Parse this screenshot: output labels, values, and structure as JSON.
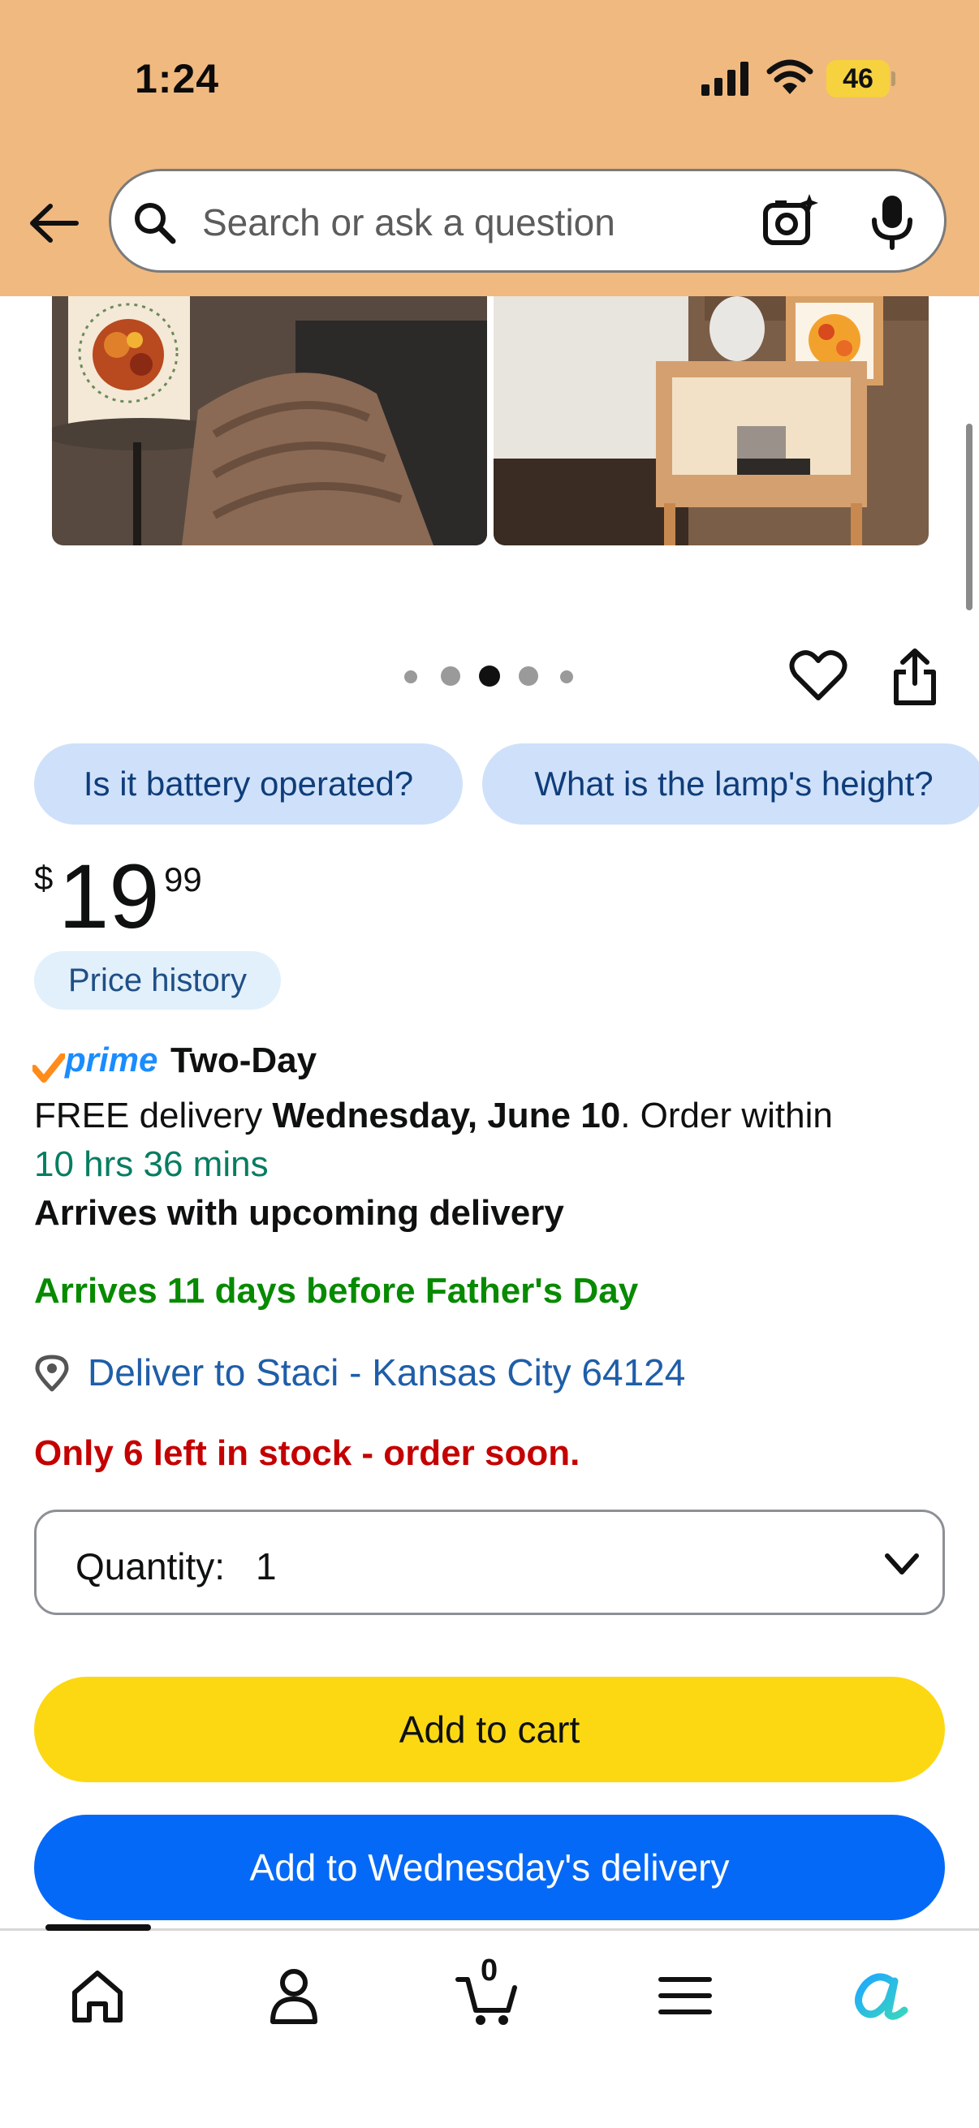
{
  "status_bar": {
    "time": "1:24",
    "battery": "46"
  },
  "search": {
    "placeholder": "Search or ask a question"
  },
  "carousel": {
    "dot_count": 5,
    "active_index": 2
  },
  "questions": [
    "Is it battery operated?",
    "What is the lamp's height?"
  ],
  "price": {
    "symbol": "$",
    "whole": "19",
    "fraction": "99",
    "history_label": "Price history"
  },
  "delivery": {
    "prime_label": "prime",
    "prime_speed": "Two-Day",
    "free_prefix": "FREE delivery ",
    "date": "Wednesday, June 10",
    "order_within": ". Order within",
    "countdown": "10 hrs 36 mins",
    "arrives_upcoming": "Arrives with upcoming delivery",
    "fathers_day": "Arrives 11 days before Father's Day",
    "deliver_to": "Deliver to Staci - Kansas City 64124",
    "stock": "Only 6 left in stock - order soon."
  },
  "quantity": {
    "label": "Quantity:",
    "value": "1"
  },
  "buttons": {
    "add_to_cart": "Add to cart",
    "add_to_delivery": "Add to Wednesday's delivery"
  },
  "bottom_nav": {
    "cart_count": "0",
    "items": [
      "home-icon",
      "account-icon",
      "cart-icon",
      "menu-icon",
      "rufus-icon"
    ]
  },
  "colors": {
    "header_bg": "#f0b97f",
    "add_to_cart": "#fcd813",
    "add_to_delivery": "#0569f8",
    "prime_blue": "#1a8cff",
    "fathers_day_green": "#078a00",
    "stock_red": "#c40000",
    "link_blue": "#1f5ea8",
    "countdown_teal": "#067d62"
  }
}
